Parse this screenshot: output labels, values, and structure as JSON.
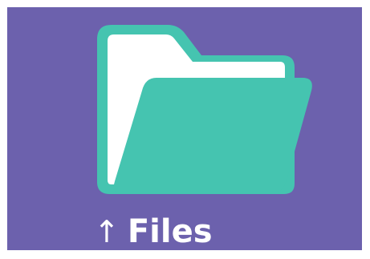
{
  "app": {
    "icon": "folder-icon",
    "label": "Files",
    "label_icon": "upload-arrow-icon",
    "label_icon_glyph": "↑"
  },
  "colors": {
    "background": "#6c61ad",
    "folder_teal": "#45c4b0",
    "paper": "#ffffff",
    "text": "#ffffff"
  }
}
